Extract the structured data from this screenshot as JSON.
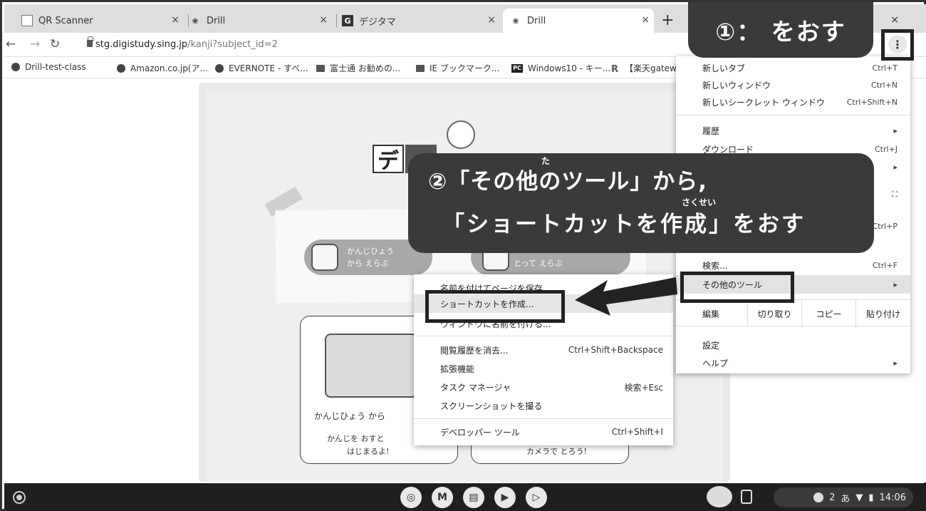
{
  "tabs": [
    {
      "title": "QR Scanner",
      "icon": "page-icon",
      "active": false
    },
    {
      "title": "Drill",
      "icon": "drill-icon",
      "active": false
    },
    {
      "title": "デジタマ",
      "icon": "g-icon",
      "active": false
    },
    {
      "title": "Drill",
      "icon": "drill-icon",
      "active": true
    }
  ],
  "tab_close": "×",
  "new_tab": "+",
  "window_buttons": "⧉ ×",
  "address": {
    "host": "stg.digistudy.sing.jp",
    "path": "/kanji?subject_id=2"
  },
  "bookmarks": [
    {
      "label": "Drill-test-class",
      "icon": "github-icon"
    },
    {
      "label": "Amazon.co.jp(ア...",
      "icon": "github-icon"
    },
    {
      "label": "EVERNOTE - すべ...",
      "icon": "github-icon"
    },
    {
      "label": "富士通 お勧めの...",
      "icon": "folder-icon"
    },
    {
      "label": "IE ブックマーク...",
      "icon": "folder-icon"
    },
    {
      "label": "Windows10 - キー...",
      "icon": "pc-icon"
    },
    {
      "label": "【楽天gatewa",
      "icon": "rakuten-icon"
    }
  ],
  "page": {
    "logo_char": "デ",
    "pill1_line1": "かんじひょう",
    "pill1_line2": "から えらぶ",
    "pill2_line2": "とって えらぶ",
    "card1_title": "かんじひょう から",
    "card1_sub1": "かんじを おすと",
    "card1_sub2": "はじまるよ!",
    "card2_sub": "カメラで とろう!"
  },
  "submenu": {
    "items": [
      {
        "label": "名前を付けてページを保存...",
        "shortcut": ""
      },
      {
        "label": "ショートカットを作成...",
        "shortcut": "",
        "highlighted": true
      },
      {
        "label": "ウィンドウに名前を付ける...",
        "shortcut": ""
      },
      {
        "label": "閲覧履歴を消去...",
        "shortcut": "Ctrl+Shift+Backspace"
      },
      {
        "label": "拡張機能",
        "shortcut": ""
      },
      {
        "label": "タスク マネージャ",
        "shortcut": "検索+Esc"
      },
      {
        "label": "スクリーンショットを撮る",
        "shortcut": ""
      },
      {
        "label": "デベロッパー ツール",
        "shortcut": "Ctrl+Shift+I"
      }
    ]
  },
  "mainmenu": {
    "items": [
      {
        "label": "新しいタブ",
        "shortcut": "Ctrl+T"
      },
      {
        "label": "新しいウィンドウ",
        "shortcut": "Ctrl+N"
      },
      {
        "label": "新しいシークレット ウィンドウ",
        "shortcut": "Ctrl+Shift+N"
      },
      {
        "label": "履歴",
        "shortcut": "▸"
      },
      {
        "label": "ダウンロード",
        "shortcut": "Ctrl+J"
      },
      {
        "label": "",
        "shortcut": "▸"
      },
      {
        "label": "",
        "shortcut": "⛶"
      },
      {
        "label": "",
        "shortcut": "Ctrl+P"
      },
      {
        "label": "検索...",
        "shortcut": "Ctrl+F"
      },
      {
        "label": "その他のツール",
        "shortcut": "▸"
      },
      {
        "label": "設定",
        "shortcut": ""
      },
      {
        "label": "ヘルプ",
        "shortcut": "▸"
      }
    ],
    "edit_label": "編集",
    "cut": "切り取り",
    "copy": "コピー",
    "paste": "貼り付け"
  },
  "callout1": "①： をおす",
  "callout2": {
    "line1": "②「その他のツール」から,",
    "line2": "「ショートカットを作成」をおす",
    "ruby_ta": "た",
    "ruby_sakusei": "さくせい"
  },
  "shelf": {
    "apps": [
      "chrome-icon",
      "gmail-icon",
      "docs-icon",
      "youtube-icon",
      "play-icon"
    ],
    "tray_badge": "2",
    "ime": "あ",
    "time": "14:06"
  }
}
